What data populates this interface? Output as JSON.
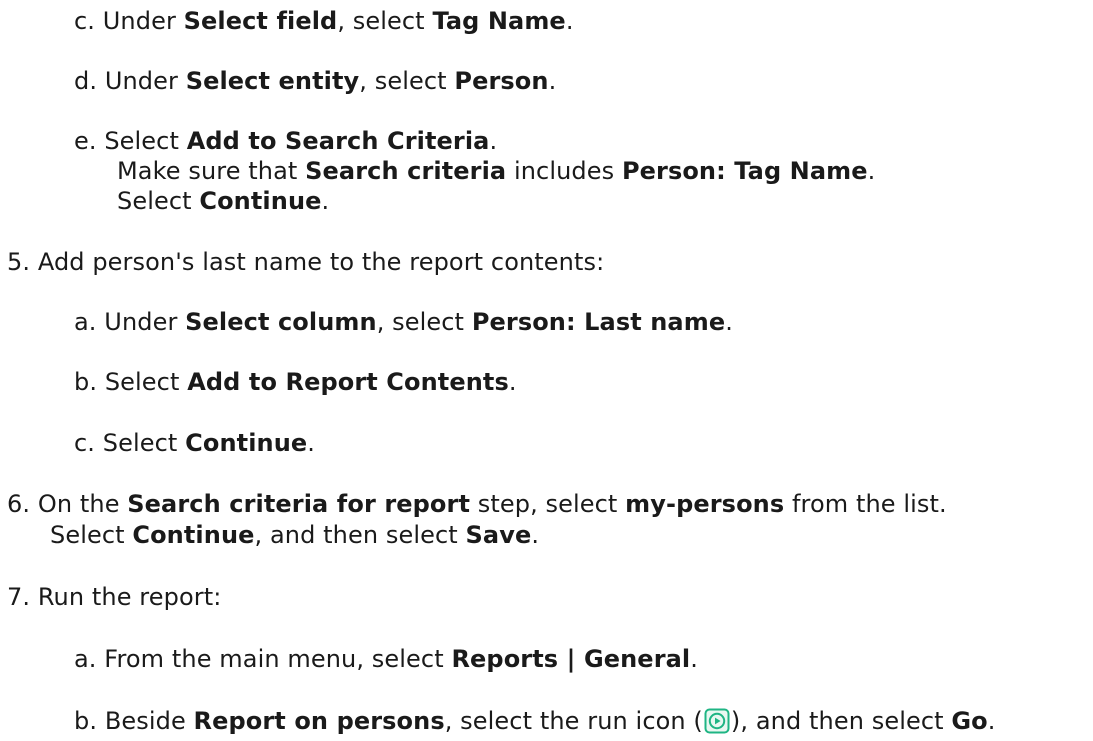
{
  "steps": {
    "s4c": {
      "marker": "c.",
      "t1": "Under ",
      "b1": "Select field",
      "t2": ", select ",
      "b2": "Tag Name",
      "t3": "."
    },
    "s4d": {
      "marker": "d.",
      "t1": "Under ",
      "b1": "Select entity",
      "t2": ", select ",
      "b2": "Person",
      "t3": "."
    },
    "s4e": {
      "marker": "e.",
      "l1": {
        "t1": "Select ",
        "b1": "Add to Search Criteria",
        "t2": "."
      },
      "l2": {
        "t1": "Make sure that ",
        "b1": "Search criteria",
        "t2": " includes ",
        "b2": "Person: Tag Name",
        "t3": "."
      },
      "l3": {
        "t1": "Select ",
        "b1": "Continue",
        "t2": "."
      }
    },
    "s5": {
      "marker": "5.",
      "text": "Add person's last name to the report contents:"
    },
    "s5a": {
      "marker": "a.",
      "t1": "Under ",
      "b1": "Select column",
      "t2": ", select ",
      "b2": "Person: Last name",
      "t3": "."
    },
    "s5b": {
      "marker": "b.",
      "t1": "Select ",
      "b1": "Add to Report Contents",
      "t2": "."
    },
    "s5c": {
      "marker": "c.",
      "t1": "Select ",
      "b1": "Continue",
      "t2": "."
    },
    "s6": {
      "marker": "6.",
      "l1": {
        "t1": "On the ",
        "b1": "Search criteria for report",
        "t2": " step, select ",
        "b2": "my-persons",
        "t3": " from the list."
      },
      "l2": {
        "t1": "Select ",
        "b1": "Continue",
        "t2": ", and then select ",
        "b2": "Save",
        "t3": "."
      }
    },
    "s7": {
      "marker": "7.",
      "text": "Run the report:"
    },
    "s7a": {
      "marker": "a.",
      "t1": "From the main menu, select ",
      "b1": "Reports | General",
      "t2": "."
    },
    "s7b": {
      "marker": "b.",
      "t1": "Beside ",
      "b1": "Report on persons",
      "t2": ", select the run icon (",
      "t3": "), and then select ",
      "b2": "Go",
      "t4": "."
    }
  },
  "icons": {
    "run_icon": "play-circle-icon",
    "run_icon_color": "#1fb584"
  }
}
